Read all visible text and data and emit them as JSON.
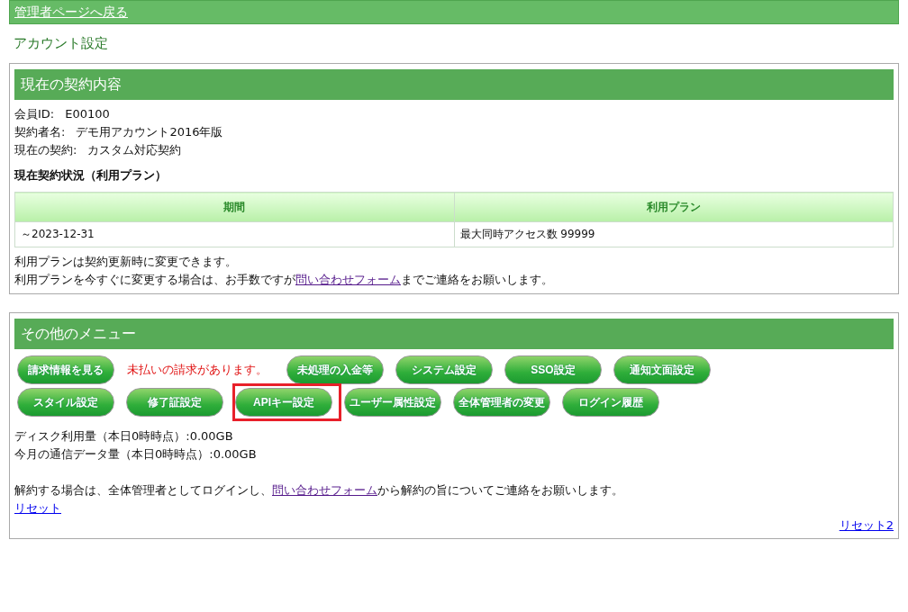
{
  "top_bar": {
    "back_link": "管理者ページへ戻る"
  },
  "page_title": "アカウント設定",
  "contract_panel": {
    "title": "現在の契約内容",
    "fields": [
      {
        "label": "会員ID:",
        "value": "E00100"
      },
      {
        "label": "契約者名:",
        "value": "デモ用アカウント2016年版"
      },
      {
        "label": "現在の契約:",
        "value": "カスタム対応契約"
      }
    ],
    "status_heading": "現在契約状況（利用プラン）",
    "table": {
      "columns": [
        "期間",
        "利用プラン"
      ],
      "rows": [
        [
          "～2023-12-31",
          "最大同時アクセス数 99999"
        ]
      ]
    },
    "notes": [
      {
        "text": "利用プランは契約更新時に変更できます。"
      },
      {
        "before": "利用プランを今すぐに変更する場合は、お手数ですが",
        "link": "問い合わせフォーム",
        "after": "までご連絡をお願いします。"
      }
    ]
  },
  "menu_panel": {
    "title": "その他のメニュー",
    "items": [
      {
        "kind": "button",
        "label": "請求情報を見る",
        "highlighted": false
      },
      {
        "kind": "notice",
        "label": "未払いの請求があります。"
      },
      {
        "kind": "button",
        "label": "未処理の入金等",
        "highlighted": false
      },
      {
        "kind": "button",
        "label": "システム設定",
        "highlighted": false
      },
      {
        "kind": "button",
        "label": "SSO設定",
        "highlighted": false
      },
      {
        "kind": "button",
        "label": "通知文面設定",
        "highlighted": false
      },
      {
        "kind": "button",
        "label": "スタイル設定",
        "highlighted": false
      },
      {
        "kind": "button",
        "label": "修了証設定",
        "highlighted": false
      },
      {
        "kind": "button",
        "label": "APIキー設定",
        "highlighted": true
      },
      {
        "kind": "button",
        "label": "ユーザー属性設定",
        "highlighted": false
      },
      {
        "kind": "button",
        "label": "全体管理者の変更",
        "highlighted": false
      },
      {
        "kind": "button",
        "label": "ログイン履歴",
        "highlighted": false
      }
    ],
    "usage": [
      "ディスク利用量（本日0時時点）:0.00GB",
      "今月の通信データ量（本日0時時点）:0.00GB"
    ],
    "cancel_note": {
      "before": "解約する場合は、全体管理者としてログインし、",
      "link": "問い合わせフォーム",
      "after": "から解約の旨についてご連絡をお願いします。"
    },
    "reset_link": "リセット",
    "reset2_link": "リセット2"
  }
}
